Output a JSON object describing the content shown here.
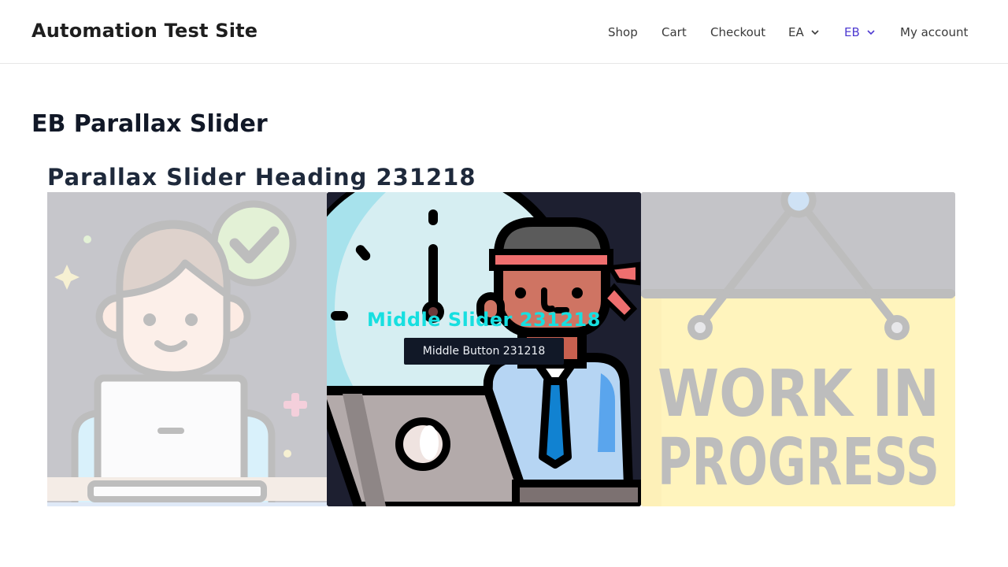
{
  "header": {
    "site_title": "Automation Test Site",
    "nav": {
      "shop": "Shop",
      "cart": "Cart",
      "checkout": "Checkout",
      "ea": "EA",
      "eb": "EB",
      "my_account": "My account"
    },
    "active_color": "#4f3bd1"
  },
  "page": {
    "title": "EB Parallax Slider"
  },
  "slider": {
    "heading": "Parallax Slider Heading 231218",
    "middle_caption": "Middle Slider 231218",
    "middle_button": "Middle Button 231218",
    "right_slide_text_line1": "WORK IN",
    "right_slide_text_line2": "PROGRESS",
    "caption_color": "#17dfe0"
  }
}
